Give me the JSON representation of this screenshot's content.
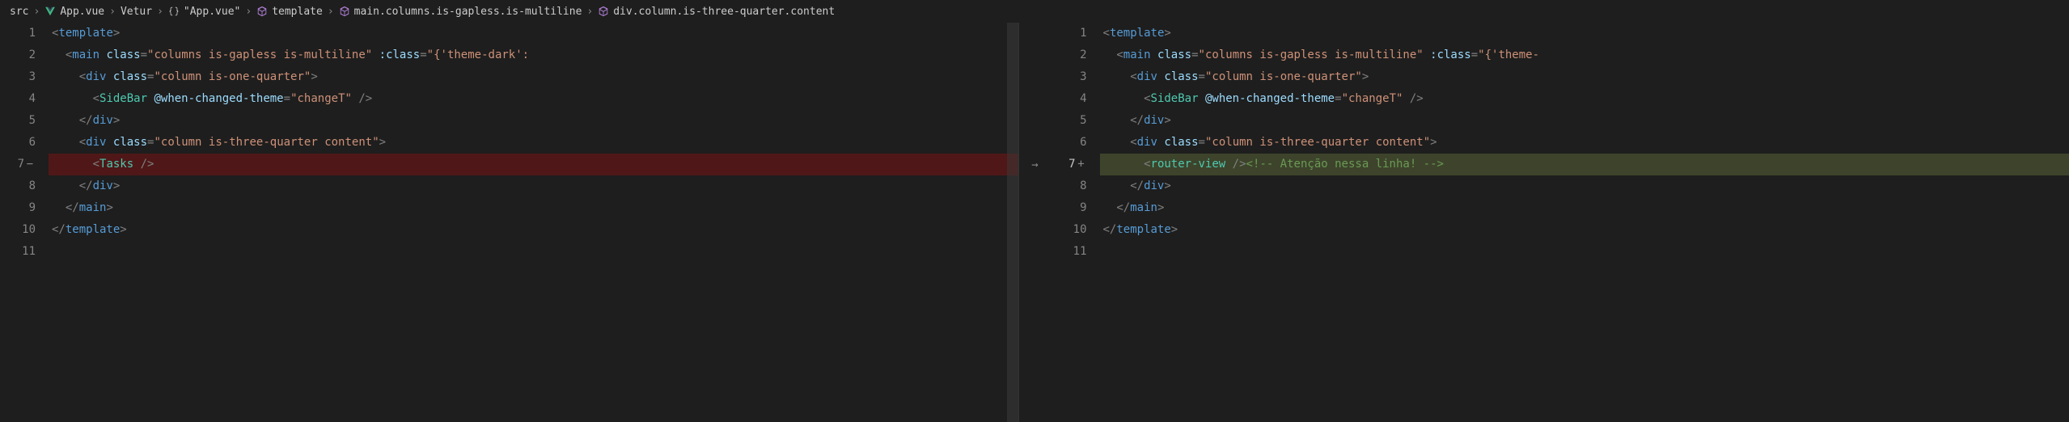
{
  "breadcrumb": {
    "items": [
      {
        "label": "src",
        "icon": "none"
      },
      {
        "label": "App.vue",
        "icon": "vue"
      },
      {
        "label": "Vetur",
        "icon": "none"
      },
      {
        "label": "\"App.vue\"",
        "icon": "braces"
      },
      {
        "label": "template",
        "icon": "cube"
      },
      {
        "label": "main.columns.is-gapless.is-multiline",
        "icon": "cube"
      },
      {
        "label": "div.column.is-three-quarter.content",
        "icon": "cube"
      }
    ]
  },
  "left": {
    "lines": [
      {
        "n": "1",
        "marker": "",
        "tokens": [
          [
            "punct",
            "<"
          ],
          [
            "tag",
            "template"
          ],
          [
            "punct",
            ">"
          ]
        ]
      },
      {
        "n": "2",
        "marker": "",
        "indent": "  ",
        "tokens": [
          [
            "punct",
            "<"
          ],
          [
            "tag",
            "main"
          ],
          [
            "text",
            " "
          ],
          [
            "attr",
            "class"
          ],
          [
            "punct",
            "="
          ],
          [
            "str",
            "\"columns is-gapless is-multiline\""
          ],
          [
            "text",
            " "
          ],
          [
            "attr",
            ":class"
          ],
          [
            "punct",
            "="
          ],
          [
            "str",
            "\"{'theme-dark':"
          ]
        ]
      },
      {
        "n": "3",
        "marker": "",
        "indent": "    ",
        "tokens": [
          [
            "punct",
            "<"
          ],
          [
            "tag",
            "div"
          ],
          [
            "text",
            " "
          ],
          [
            "attr",
            "class"
          ],
          [
            "punct",
            "="
          ],
          [
            "str",
            "\"column is-one-quarter\""
          ],
          [
            "punct",
            ">"
          ]
        ]
      },
      {
        "n": "4",
        "marker": "",
        "indent": "      ",
        "tokens": [
          [
            "punct",
            "<"
          ],
          [
            "comp",
            "SideBar"
          ],
          [
            "text",
            " "
          ],
          [
            "attr",
            "@when-changed-theme"
          ],
          [
            "punct",
            "="
          ],
          [
            "str",
            "\"changeT\""
          ],
          [
            "text",
            " "
          ],
          [
            "punct",
            "/>"
          ]
        ]
      },
      {
        "n": "5",
        "marker": "",
        "indent": "    ",
        "tokens": [
          [
            "punct",
            "</"
          ],
          [
            "tag",
            "div"
          ],
          [
            "punct",
            ">"
          ]
        ]
      },
      {
        "n": "6",
        "marker": "",
        "indent": "    ",
        "tokens": [
          [
            "punct",
            "<"
          ],
          [
            "tag",
            "div"
          ],
          [
            "text",
            " "
          ],
          [
            "attr",
            "class"
          ],
          [
            "punct",
            "="
          ],
          [
            "str",
            "\"column is-three-quarter content\""
          ],
          [
            "punct",
            ">"
          ]
        ]
      },
      {
        "n": "7",
        "marker": "−",
        "indent": "      ",
        "class": "removed",
        "tokens": [
          [
            "punct",
            "<"
          ],
          [
            "comp",
            "Tasks"
          ],
          [
            "text",
            " "
          ],
          [
            "punct",
            "/>"
          ]
        ]
      },
      {
        "n": "8",
        "marker": "",
        "indent": "    ",
        "tokens": [
          [
            "punct",
            "</"
          ],
          [
            "tag",
            "div"
          ],
          [
            "punct",
            ">"
          ]
        ]
      },
      {
        "n": "9",
        "marker": "",
        "indent": "  ",
        "tokens": [
          [
            "punct",
            "</"
          ],
          [
            "tag",
            "main"
          ],
          [
            "punct",
            ">"
          ]
        ]
      },
      {
        "n": "10",
        "marker": "",
        "tokens": [
          [
            "punct",
            "</"
          ],
          [
            "tag",
            "template"
          ],
          [
            "punct",
            ">"
          ]
        ]
      },
      {
        "n": "11",
        "marker": "",
        "tokens": []
      }
    ]
  },
  "right": {
    "lines": [
      {
        "n": "1",
        "marker": "",
        "tokens": [
          [
            "punct",
            "<"
          ],
          [
            "tag",
            "template"
          ],
          [
            "punct",
            ">"
          ]
        ]
      },
      {
        "n": "2",
        "marker": "",
        "indent": "  ",
        "tokens": [
          [
            "punct",
            "<"
          ],
          [
            "tag",
            "main"
          ],
          [
            "text",
            " "
          ],
          [
            "attr",
            "class"
          ],
          [
            "punct",
            "="
          ],
          [
            "str",
            "\"columns is-gapless is-multiline\""
          ],
          [
            "text",
            " "
          ],
          [
            "attr",
            ":class"
          ],
          [
            "punct",
            "="
          ],
          [
            "str",
            "\"{'theme-"
          ]
        ]
      },
      {
        "n": "3",
        "marker": "",
        "indent": "    ",
        "tokens": [
          [
            "punct",
            "<"
          ],
          [
            "tag",
            "div"
          ],
          [
            "text",
            " "
          ],
          [
            "attr",
            "class"
          ],
          [
            "punct",
            "="
          ],
          [
            "str",
            "\"column is-one-quarter\""
          ],
          [
            "punct",
            ">"
          ]
        ]
      },
      {
        "n": "4",
        "marker": "",
        "indent": "      ",
        "tokens": [
          [
            "punct",
            "<"
          ],
          [
            "comp",
            "SideBar"
          ],
          [
            "text",
            " "
          ],
          [
            "attr",
            "@when-changed-theme"
          ],
          [
            "punct",
            "="
          ],
          [
            "str",
            "\"changeT\""
          ],
          [
            "text",
            " "
          ],
          [
            "punct",
            "/>"
          ]
        ]
      },
      {
        "n": "5",
        "marker": "",
        "indent": "    ",
        "tokens": [
          [
            "punct",
            "</"
          ],
          [
            "tag",
            "div"
          ],
          [
            "punct",
            ">"
          ]
        ]
      },
      {
        "n": "6",
        "marker": "",
        "indent": "    ",
        "tokens": [
          [
            "punct",
            "<"
          ],
          [
            "tag",
            "div"
          ],
          [
            "text",
            " "
          ],
          [
            "attr",
            "class"
          ],
          [
            "punct",
            "="
          ],
          [
            "str",
            "\"column is-three-quarter content\""
          ],
          [
            "punct",
            ">"
          ]
        ]
      },
      {
        "n": "7",
        "marker": "+",
        "indent": "      ",
        "class": "added highlight",
        "tokens": [
          [
            "punct",
            "<"
          ],
          [
            "comp",
            "router-view"
          ],
          [
            "text",
            " "
          ],
          [
            "punct",
            "/>"
          ],
          [
            "comment",
            "<!-- Atenção nessa linha! -->"
          ]
        ]
      },
      {
        "n": "8",
        "marker": "",
        "indent": "    ",
        "tokens": [
          [
            "punct",
            "</"
          ],
          [
            "tag",
            "div"
          ],
          [
            "punct",
            ">"
          ]
        ]
      },
      {
        "n": "9",
        "marker": "",
        "indent": "  ",
        "tokens": [
          [
            "punct",
            "</"
          ],
          [
            "tag",
            "main"
          ],
          [
            "punct",
            ">"
          ]
        ]
      },
      {
        "n": "10",
        "marker": "",
        "tokens": [
          [
            "punct",
            "</"
          ],
          [
            "tag",
            "template"
          ],
          [
            "punct",
            ">"
          ]
        ]
      },
      {
        "n": "11",
        "marker": "",
        "tokens": []
      }
    ]
  },
  "arrow_row": 7,
  "arrow_glyph": "→"
}
